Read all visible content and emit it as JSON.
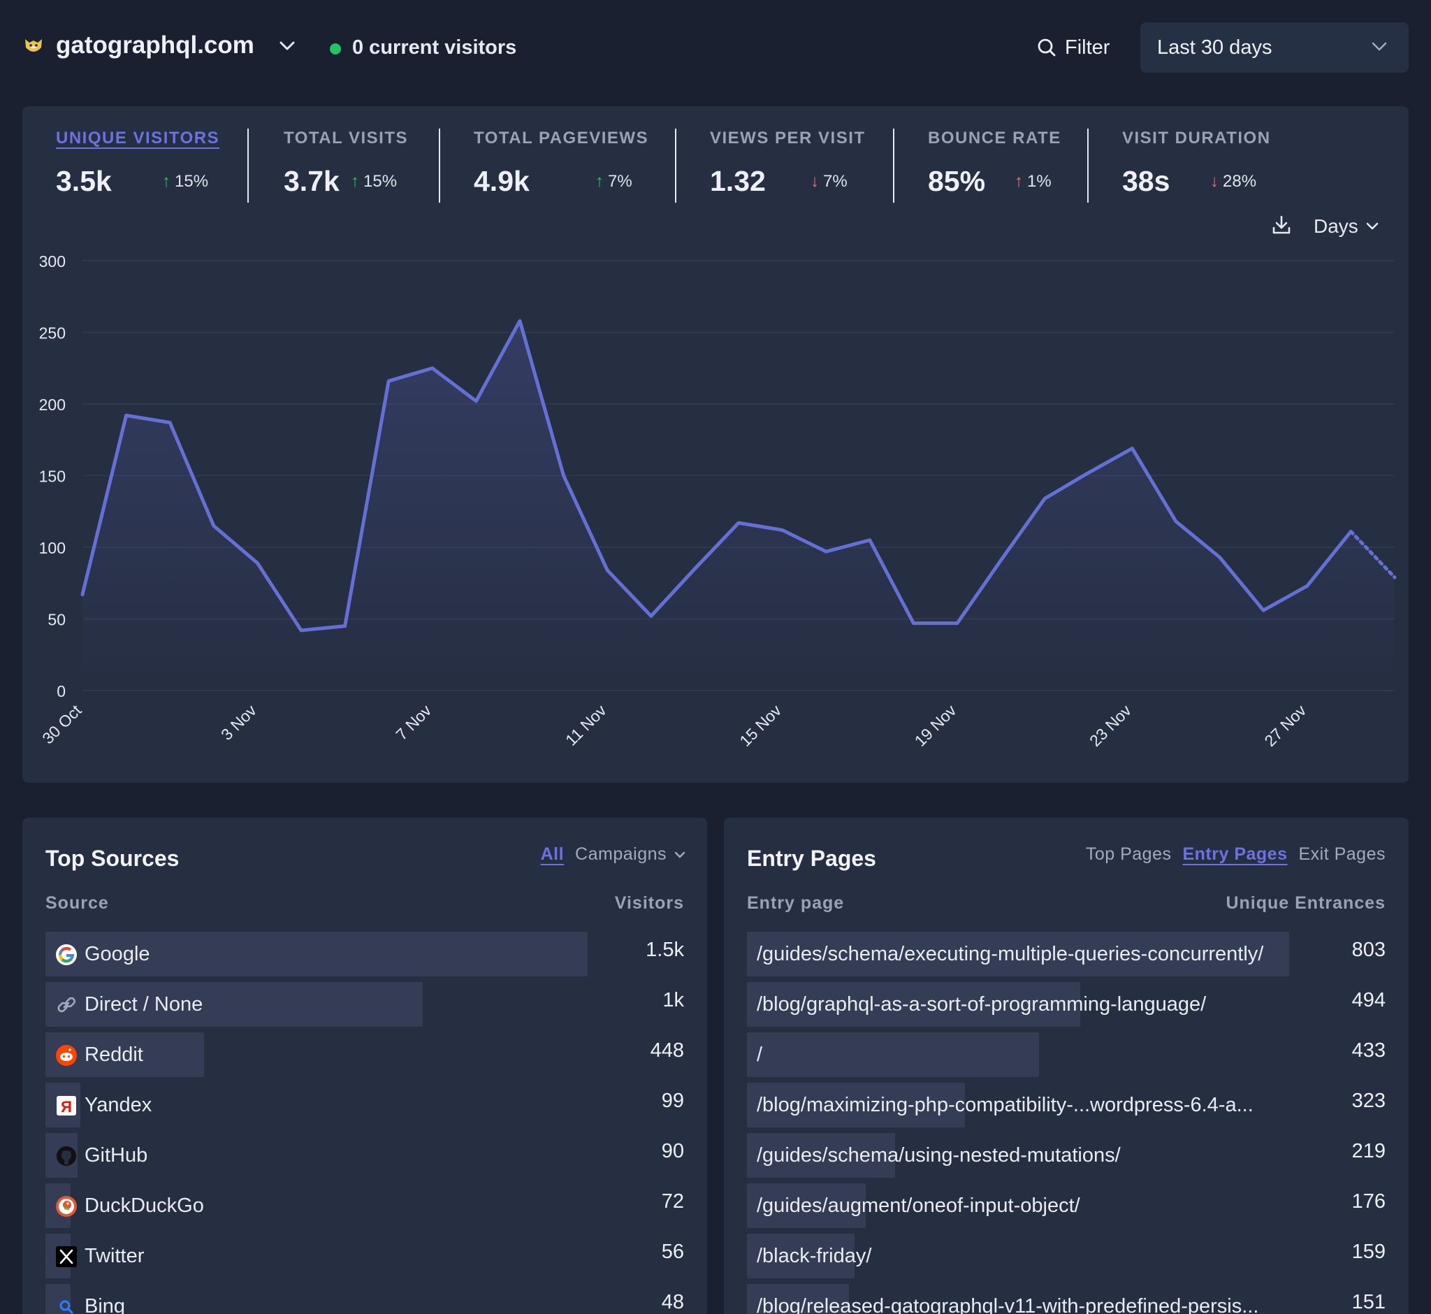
{
  "header": {
    "site": "gatographql.com",
    "live": "0 current visitors",
    "filter": "Filter",
    "period": "Last 30 days"
  },
  "stats": [
    {
      "label": "UNIQUE VISITORS",
      "value": "3.5k",
      "change": "15%",
      "dir": "up",
      "good": true
    },
    {
      "label": "TOTAL VISITS",
      "value": "3.7k",
      "change": "15%",
      "dir": "up",
      "good": true
    },
    {
      "label": "TOTAL PAGEVIEWS",
      "value": "4.9k",
      "change": "7%",
      "dir": "up",
      "good": true
    },
    {
      "label": "VIEWS PER VISIT",
      "value": "1.32",
      "change": "7%",
      "dir": "down",
      "good": false
    },
    {
      "label": "BOUNCE RATE",
      "value": "85%",
      "change": "1%",
      "dir": "up",
      "good": false
    },
    {
      "label": "VISIT DURATION",
      "value": "38s",
      "change": "28%",
      "dir": "down",
      "good": false
    }
  ],
  "interval": "Days",
  "chart_data": {
    "type": "area",
    "title": "",
    "xlabel": "",
    "ylabel": "",
    "ylim": [
      0,
      300
    ],
    "yticks": [
      0,
      50,
      100,
      150,
      200,
      250,
      300
    ],
    "x": [
      "30 Oct",
      "31 Oct",
      "1 Nov",
      "2 Nov",
      "3 Nov",
      "4 Nov",
      "5 Nov",
      "6 Nov",
      "7 Nov",
      "8 Nov",
      "9 Nov",
      "10 Nov",
      "11 Nov",
      "12 Nov",
      "13 Nov",
      "14 Nov",
      "15 Nov",
      "16 Nov",
      "17 Nov",
      "18 Nov",
      "19 Nov",
      "20 Nov",
      "21 Nov",
      "22 Nov",
      "23 Nov",
      "24 Nov",
      "25 Nov",
      "26 Nov",
      "27 Nov",
      "28 Nov",
      "29 Nov"
    ],
    "xtick_labels": [
      "30 Oct",
      "3 Nov",
      "7 Nov",
      "11 Nov",
      "15 Nov",
      "19 Nov",
      "23 Nov",
      "27 Nov"
    ],
    "series": [
      {
        "name": "",
        "values": [
          67,
          192,
          187,
          115,
          89,
          42,
          45,
          216,
          225,
          202,
          258,
          150,
          84,
          52,
          85,
          117,
          112,
          97,
          105,
          47,
          47,
          91,
          134,
          152,
          169,
          118,
          93,
          56,
          73,
          111,
          79
        ]
      }
    ],
    "partial_from_index": 29,
    "color": "#6570d4",
    "grid": true,
    "legend": "none"
  },
  "top_sources": {
    "title": "Top Sources",
    "tabs": [
      "All",
      "Campaigns"
    ],
    "col_source": "Source",
    "col_visitors": "Visitors",
    "rows": [
      {
        "name": "Google",
        "count": "1.5k",
        "fraction": 1.0,
        "icon": "google-icon"
      },
      {
        "name": "Direct / None",
        "count": "1k",
        "fraction": 0.696,
        "icon": "link-icon"
      },
      {
        "name": "Reddit",
        "count": "448",
        "fraction": 0.292,
        "icon": "reddit-icon"
      },
      {
        "name": "Yandex",
        "count": "99",
        "fraction": 0.064,
        "icon": "yandex-icon"
      },
      {
        "name": "GitHub",
        "count": "90",
        "fraction": 0.059,
        "icon": "github-icon"
      },
      {
        "name": "DuckDuckGo",
        "count": "72",
        "fraction": 0.047,
        "icon": "duckduckgo-icon"
      },
      {
        "name": "Twitter",
        "count": "56",
        "fraction": 0.037,
        "icon": "x-icon"
      },
      {
        "name": "Bing",
        "count": "48",
        "fraction": 0.031,
        "icon": "bing-icon"
      }
    ]
  },
  "entry_pages": {
    "title": "Entry Pages",
    "tabs": [
      "Top Pages",
      "Entry Pages",
      "Exit Pages"
    ],
    "col_page": "Entry page",
    "col_count": "Unique Entrances",
    "rows": [
      {
        "name": "/guides/schema/executing-multiple-queries-concurrently/",
        "count": "803",
        "fraction": 1.0
      },
      {
        "name": "/blog/graphql-as-a-sort-of-programming-language/",
        "count": "494",
        "fraction": 0.615
      },
      {
        "name": "/",
        "count": "433",
        "fraction": 0.539
      },
      {
        "name": "/blog/maximizing-php-compatibility-...wordpress-6.4-a...",
        "count": "323",
        "fraction": 0.402
      },
      {
        "name": "/guides/schema/using-nested-mutations/",
        "count": "219",
        "fraction": 0.273
      },
      {
        "name": "/guides/augment/oneof-input-object/",
        "count": "176",
        "fraction": 0.219
      },
      {
        "name": "/black-friday/",
        "count": "159",
        "fraction": 0.198
      },
      {
        "name": "/blog/released-gatographql-v11-with-predefined-persis...",
        "count": "151",
        "fraction": 0.188
      }
    ]
  }
}
